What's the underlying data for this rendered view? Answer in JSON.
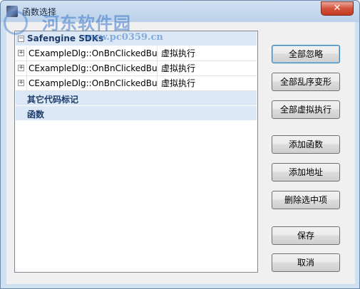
{
  "window": {
    "title": "函数选择",
    "close_label": "✕"
  },
  "watermark": {
    "text": "河东软件园",
    "url": "www.pc0359.cn"
  },
  "tree": {
    "groups": [
      {
        "label": "Safengine SDKs"
      },
      {
        "label": "其它代码标记"
      },
      {
        "label": "函数"
      }
    ],
    "items": [
      {
        "name": "CExampleDlg::OnBnClickedButte",
        "action": "虚拟执行",
        "expander": "+"
      },
      {
        "name": "CExampleDlg::OnBnClickedButte",
        "action": "虚拟执行",
        "expander": "+"
      },
      {
        "name": "CExampleDlg::OnBnClickedButte",
        "action": "虚拟执行",
        "expander": "+"
      }
    ],
    "collapse_glyph": "−"
  },
  "buttons": {
    "ignore_all": "全部忽略",
    "mutate_all": "全部乱序变形",
    "virtualize_all": "全部虚拟执行",
    "add_function": "添加函数",
    "add_address": "添加地址",
    "delete_selected": "删除选中项",
    "save": "保存",
    "cancel": "取消"
  }
}
